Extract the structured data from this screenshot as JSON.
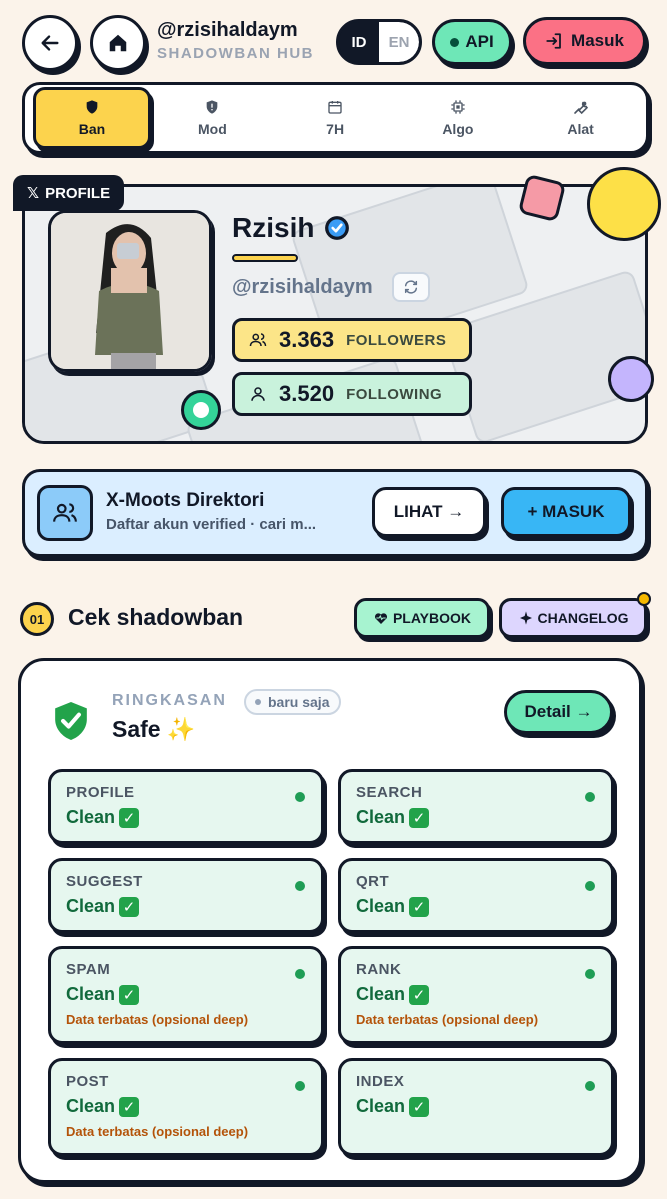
{
  "header": {
    "username": "@rzisihaldaym",
    "subtitle": "SHADOWBAN HUB",
    "lang_active": "ID",
    "lang_other": "EN",
    "api_label": "API",
    "login_label": "Masuk"
  },
  "tabs": [
    {
      "label": "Ban",
      "icon": "shield-icon"
    },
    {
      "label": "Mod",
      "icon": "shield-alert-icon"
    },
    {
      "label": "7H",
      "icon": "calendar-icon"
    },
    {
      "label": "Algo",
      "icon": "chip-icon"
    },
    {
      "label": "Alat",
      "icon": "wrench-icon"
    }
  ],
  "profile": {
    "tag": "PROFILE",
    "tag_glyph": "𝕏",
    "name": "Rzisih",
    "handle": "@rzisihaldaym",
    "followers_count": "3.363",
    "followers_label": "FOLLOWERS",
    "following_count": "3.520",
    "following_label": "FOLLOWING"
  },
  "directory": {
    "title": "X-Moots Direktori",
    "subtitle": "Daftar akun verified · cari m...",
    "view_label": "LIHAT →",
    "join_label": "+ MASUK"
  },
  "section": {
    "number": "01",
    "title": "Cek shadowban",
    "playbook_label": "PLAYBOOK",
    "changelog_label": "CHANGELOG"
  },
  "summary": {
    "label": "RINGKASAN",
    "time_badge": "baru saja",
    "status": "Safe",
    "status_emoji": "✨",
    "detail_label": "Detail →"
  },
  "checks": [
    {
      "title": "PROFILE",
      "value": "Clean",
      "note": ""
    },
    {
      "title": "SEARCH",
      "value": "Clean",
      "note": ""
    },
    {
      "title": "SUGGEST",
      "value": "Clean",
      "note": ""
    },
    {
      "title": "QRT",
      "value": "Clean",
      "note": ""
    },
    {
      "title": "SPAM",
      "value": "Clean",
      "note": "Data terbatas (opsional deep)"
    },
    {
      "title": "RANK",
      "value": "Clean",
      "note": "Data terbatas (opsional deep)"
    },
    {
      "title": "POST",
      "value": "Clean",
      "note": "Data terbatas (opsional deep)"
    },
    {
      "title": "INDEX",
      "value": "Clean",
      "note": ""
    }
  ],
  "colors": {
    "accent_yellow": "#fcd34d",
    "accent_green": "#6ee7b7",
    "accent_red": "#fb7185",
    "accent_blue": "#38bdf8",
    "clean_green": "#116a3c"
  }
}
